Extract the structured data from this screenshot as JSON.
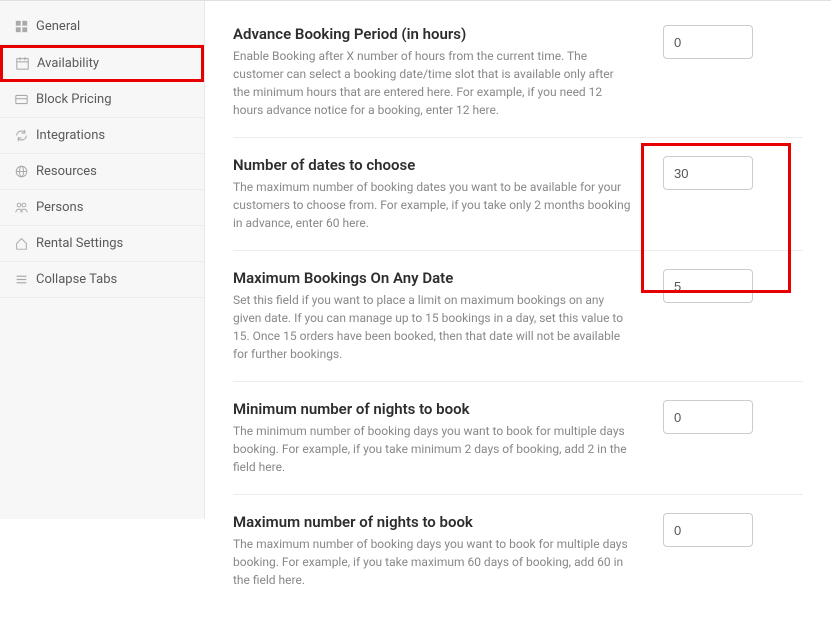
{
  "sidebar": {
    "items": [
      {
        "label": "General"
      },
      {
        "label": "Availability"
      },
      {
        "label": "Block Pricing"
      },
      {
        "label": "Integrations"
      },
      {
        "label": "Resources"
      },
      {
        "label": "Persons"
      },
      {
        "label": "Rental Settings"
      },
      {
        "label": "Collapse Tabs"
      }
    ]
  },
  "fields": {
    "advance": {
      "title": "Advance Booking Period (in hours)",
      "desc": "Enable Booking after X number of hours from the current time. The customer can select a booking date/time slot that is available only after the minimum hours that are entered here. For example, if you need 12 hours advance notice for a booking, enter 12 here.",
      "value": "0"
    },
    "num_dates": {
      "title": "Number of dates to choose",
      "desc": "The maximum number of booking dates you want to be available for your customers to choose from. For example, if you take only 2 months booking in advance, enter 60 here.",
      "value": "30"
    },
    "max_bookings": {
      "title": "Maximum Bookings On Any Date",
      "desc": "Set this field if you want to place a limit on maximum bookings on any given date. If you can manage up to 15 bookings in a day, set this value to 15. Once 15 orders have been booked, then that date will not be available for further bookings.",
      "value": "5"
    },
    "min_nights": {
      "title": "Minimum number of nights to book",
      "desc": "The minimum number of booking days you want to book for multiple days booking. For example, if you take minimum 2 days of booking, add 2 in the field here.",
      "value": "0"
    },
    "max_nights": {
      "title": "Maximum number of nights to book",
      "desc": "The maximum number of booking days you want to book for multiple days booking. For example, if you take maximum 60 days of booking, add 60 in the field here.",
      "value": "0"
    }
  }
}
